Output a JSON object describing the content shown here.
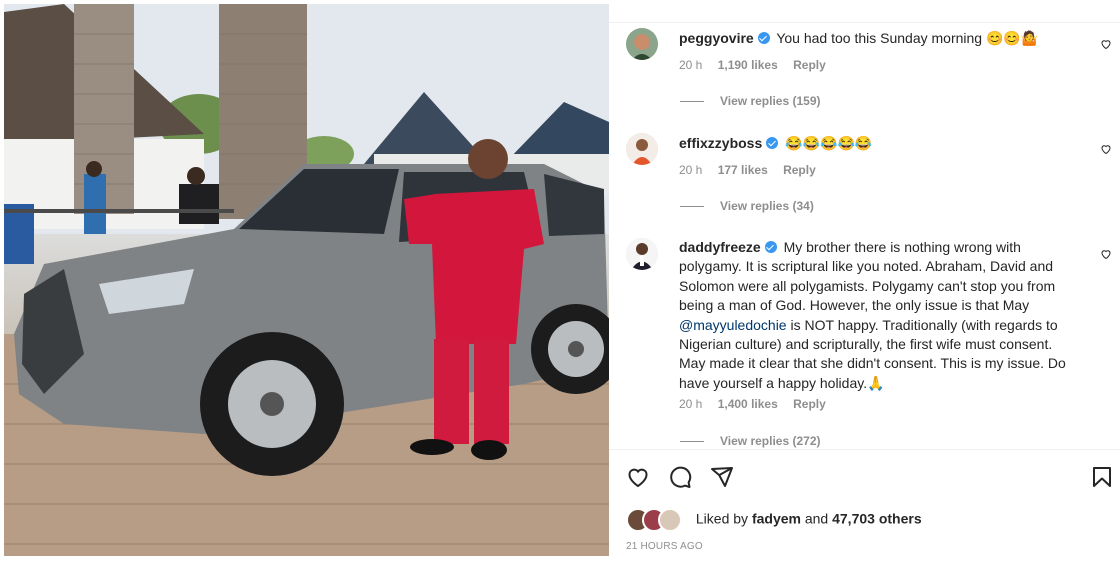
{
  "post": {
    "photo_description_icon": "post-photo"
  },
  "comments": [
    {
      "username": "peggyovire",
      "text": "You had too this Sunday morning",
      "emojis": [
        "😊",
        "😊",
        "🤷"
      ],
      "time": "20 h",
      "likes": "1,190 likes",
      "reply": "Reply",
      "view_replies": "View replies (159)"
    },
    {
      "username": "effixzzyboss",
      "text": "",
      "emojis": [
        "😂",
        "😂",
        "😂",
        "😂",
        "😂"
      ],
      "time": "20 h",
      "likes": "177 likes",
      "reply": "Reply",
      "view_replies": "View replies (34)"
    },
    {
      "username": "daddyfreeze",
      "text_before": "My brother there is nothing wrong with polygamy. It is scriptural like you noted. Abraham, David and Solomon were all polygamists. Polygamy can't stop you from being a man of God. However, the only issue is that May ",
      "mention": "@mayyuledochie",
      "text_after": " is NOT happy. Traditionally (with regards to Nigerian culture) and scripturally, the first wife must consent. May made it clear that she didn't consent. This is my issue. Do have yourself a happy holiday.",
      "emojis": [
        "🙏"
      ],
      "time": "20 h",
      "likes": "1,400 likes",
      "reply": "Reply",
      "view_replies": "View replies (272)"
    }
  ],
  "footer": {
    "liked_prefix": "Liked by",
    "liked_user": "fadyem",
    "liked_and": "and",
    "liked_others": "47,703 others",
    "timestamp": "21 HOURS AGO"
  },
  "icons": [
    "heart-icon",
    "comment-icon",
    "share-icon",
    "bookmark-icon",
    "verified-badge-icon"
  ],
  "colors": {
    "verified": "#3897f0",
    "text_primary": "#262626",
    "text_secondary": "#8e8e8e",
    "mention": "#00376b"
  }
}
